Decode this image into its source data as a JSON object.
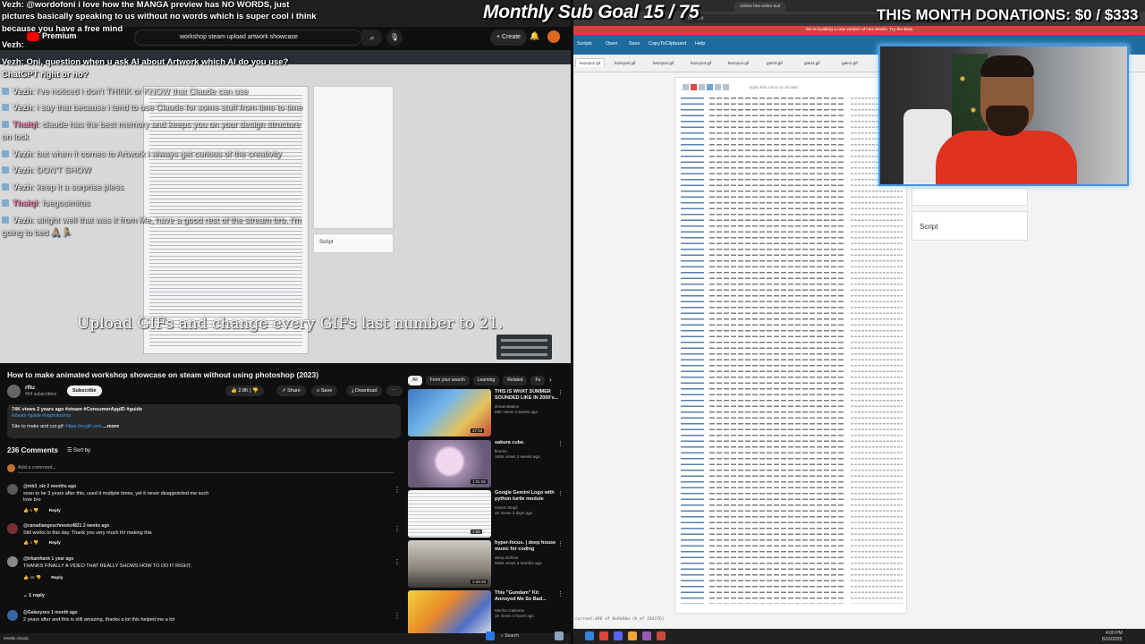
{
  "overlay": {
    "goal": "Monthly Sub Goal 15 / 75",
    "donations": "THIS MONTH DONATIONS: $0 / $333"
  },
  "chat": [
    {
      "name": "Vezh",
      "text": ": @wordofoni i love how the MANGA preview has NO WORDS, just"
    },
    {
      "name": "",
      "text": "pictures basically speaking to us without no words which is super cool i think"
    },
    {
      "name": "",
      "text": "because you have a free mind"
    },
    {
      "name": "Vezh",
      "text": ":"
    },
    {
      "name": "Vezh",
      "text": ": Oni, question when u ask AI about Artwork which AI do you use?"
    },
    {
      "name": "",
      "text": "ChatGPT right or no?"
    },
    {
      "name": "Vezh",
      "text": ": i've noticed i don't THINK or KNOW that Claude can use"
    },
    {
      "name": "Vezh",
      "text": ": i say that because i tend to use Claude for some stuff from time to time"
    },
    {
      "name": "Thaiqi",
      "text": ": claude has the best memory and keeps you on your design structure"
    },
    {
      "name": "",
      "text": "on lock"
    },
    {
      "name": "Vezh",
      "text": ": but when it comes to Artwork i always get curious of the creativity"
    },
    {
      "name": "Vezh",
      "text": ": DON'T SHOW"
    },
    {
      "name": "Vezh",
      "text": ": keep it a surprise pless"
    },
    {
      "name": "Thaiqi",
      "text": ": fuegosimitos"
    },
    {
      "name": "Vezh",
      "text": ": alright well that was it from Me, have a good rest of the stream bro. i'm"
    },
    {
      "name": "",
      "text": "going to bed 🙏🏽🏃"
    }
  ],
  "youtube": {
    "search_query": "workshop steam upload artwork showcase",
    "create_label": "+ Create",
    "caption": "Upload GIFs and change every GIFs last number to 21.",
    "video_script_label": "Script",
    "title": "How to make animated workshop showcase on steam without using photoshop (2023)",
    "channel": "rftu",
    "subscribers": "454 subscribers",
    "subscribe": "Subscribe",
    "likes": "2.8K",
    "share": "Share",
    "save": "Save",
    "download": "Download",
    "desc_meta": "74K views  2 years ago  #steam #ConsumerAppID #guide",
    "desc_tags": "#steam #guide #nophotoshop",
    "desc_text": "Site to make and cut gif: ",
    "desc_link": "https://ezgif.com",
    "desc_more": "...more",
    "comments_count": "236 Comments",
    "sort_by": "Sort by",
    "add_comment": "Add a comment...",
    "comments": [
      {
        "user": "@mb3_ole  2 months ago",
        "text": "soon to be 3 years after this, used it multiple times, yet it never disappointed me such love bro",
        "likes": "5",
        "reply": "Reply"
      },
      {
        "user": "@canadiangeschnootz4821  2 weeks ago",
        "text": "Still works to this day. Thank you very much for making this",
        "likes": "3",
        "reply": "Reply"
      },
      {
        "user": "@trkamhank  1 year ago",
        "text": "THANKS FINALLY A VIDEO THAT REALLY SHOWS HOW TO DO IT RIGHT.",
        "likes": "46",
        "reply": "Reply"
      },
      {
        "user": "@Galaxyxes  1 month ago",
        "text": "2 years after and this is still amazing, thanks a lot this helped me a lot",
        "likes": "",
        "reply": ""
      }
    ],
    "replies_toggle": "1 reply",
    "chips": [
      "All",
      "From your search",
      "Learning",
      "Related",
      "Fo"
    ],
    "related": [
      {
        "title": "THIS IS WHAT SUMMER SOUNDED LIKE IN 2000's...",
        "channel": "Dreamstation",
        "meta": "66K views  3 weeks ago",
        "duration": "37:03"
      },
      {
        "title": "sakura cube.",
        "channel": "flmmm",
        "meta": "169K views  2 weeks ago",
        "duration": "1:01:50"
      },
      {
        "title": "Google Gemini Logo with python turtle module",
        "channel": "Harvic Singh",
        "meta": "4K views  2 days ago",
        "duration": "1:06"
      },
      {
        "title": "hyper-focus. | deep house music for coding",
        "channel": "deep.archive",
        "meta": "535K views  3 months ago",
        "duration": "2:28:28"
      },
      {
        "title": "This \"Gundam\" Kit Annoyed Me So Bad...",
        "channel": "Mecha Gaikotsu",
        "meta": "1K views  4 hours ago",
        "duration": ""
      }
    ]
  },
  "hex_editor": {
    "tabs": [
      "Scripts",
      "Open",
      "Save",
      "CopyToClipboard",
      "Help"
    ],
    "browser_tab": "Online hex editor tool",
    "url": "hexed.it",
    "banner": "We're building a new version of Hex Works.  Try the Beta",
    "files": [
      "kazoyu1.gif",
      "kazoyu0.gif",
      "kazoyu2.gif",
      "kazoyu3.gif",
      "kazoyu4.gif",
      "gato0.gif",
      "gato4.gif",
      "gato1.gif"
    ],
    "apply_label": "Apply this colour to all data",
    "side_label": "Script",
    "status": "current:096 of 0xAAA0a (0 of 264176)"
  },
  "taskbar": {
    "search": "Search",
    "time": "4:00 PM",
    "date": "6/16/2025",
    "weather": "Mostly cloudy"
  }
}
